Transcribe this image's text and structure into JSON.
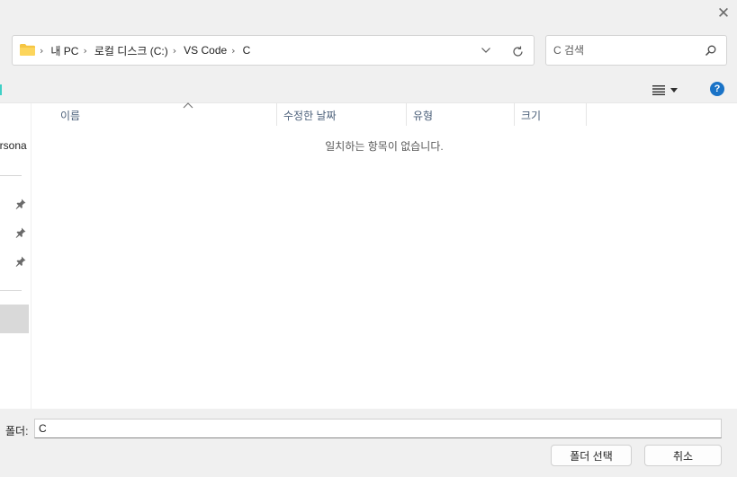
{
  "titlebar": {
    "close_glyph": "✕",
    "close_icon": "close-icon"
  },
  "address_bar": {
    "folder_icon": "folder-icon",
    "breadcrumbs": [
      "내 PC",
      "로컬 디스크 (C:)",
      "VS Code",
      "C"
    ],
    "separator_glyph": "›"
  },
  "search": {
    "placeholder": "C 검색",
    "value": ""
  },
  "navigation": {
    "partial_label": "ersona"
  },
  "columns": [
    "이름",
    "수정한 날짜",
    "유형",
    "크기"
  ],
  "empty_message": "일치하는 항목이 없습니다.",
  "footer": {
    "folder_label": "폴더:",
    "folder_value": "C",
    "select_button": "폴더 선택",
    "cancel_button": "취소"
  },
  "help_glyph": "?",
  "colors": {
    "chrome_bg": "#f0f0f0",
    "help_blue": "#1a73c7",
    "folder_yellow": "#f5c543",
    "header_text": "#4c607a"
  }
}
